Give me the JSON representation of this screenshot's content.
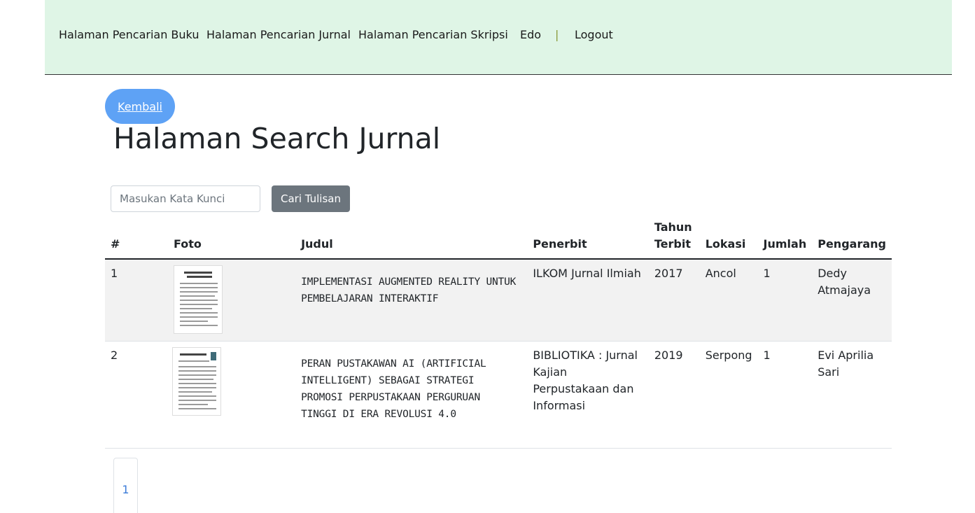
{
  "nav": {
    "items": [
      "Halaman Pencarian Buku",
      "Halaman Pencarian Jurnal",
      "Halaman Pencarian Skripsi"
    ],
    "user": "Edo",
    "separator": "|",
    "logout": "Logout"
  },
  "back_label": "Kembali",
  "page_title": "Halaman Search Jurnal",
  "search": {
    "placeholder": "Masukan Kata Kunci",
    "value": "",
    "button_label": "Cari Tulisan"
  },
  "table": {
    "headers": [
      "#",
      "Foto",
      "Judul",
      "Penerbit",
      "Tahun Terbit",
      "Lokasi",
      "Jumlah",
      "Pengarang"
    ],
    "rows": [
      {
        "no": "1",
        "foto": "journal-cover-thumbnail",
        "judul": "IMPLEMENTASI AUGMENTED REALITY UNTUK PEMBELAJARAN INTERAKTIF",
        "penerbit": "ILKOM Jurnal Ilmiah",
        "tahun": "2017",
        "lokasi": "Ancol",
        "jumlah": "1",
        "pengarang": "Dedy Atmajaya"
      },
      {
        "no": "2",
        "foto": "journal-cover-thumbnail",
        "judul": "PERAN PUSTAKAWAN AI (ARTIFICIAL INTELLIGENT) SEBAGAI STRATEGI PROMOSI PERPUSTAKAAN PERGURUAN TINGGI DI ERA REVOLUSI 4.0",
        "penerbit": "BIBLIOTIKA : Jurnal Kajian Perpustakaan dan Informasi",
        "tahun": "2019",
        "lokasi": "Serpong",
        "jumlah": "1",
        "pengarang": "Evi Aprilia Sari"
      }
    ]
  },
  "pagination": {
    "current": "1"
  },
  "colors": {
    "navbar_bg": "#dff5e6",
    "back_button": "#5ea2f5",
    "search_button": "#6c757d",
    "page_link": "#3b7bd8"
  }
}
